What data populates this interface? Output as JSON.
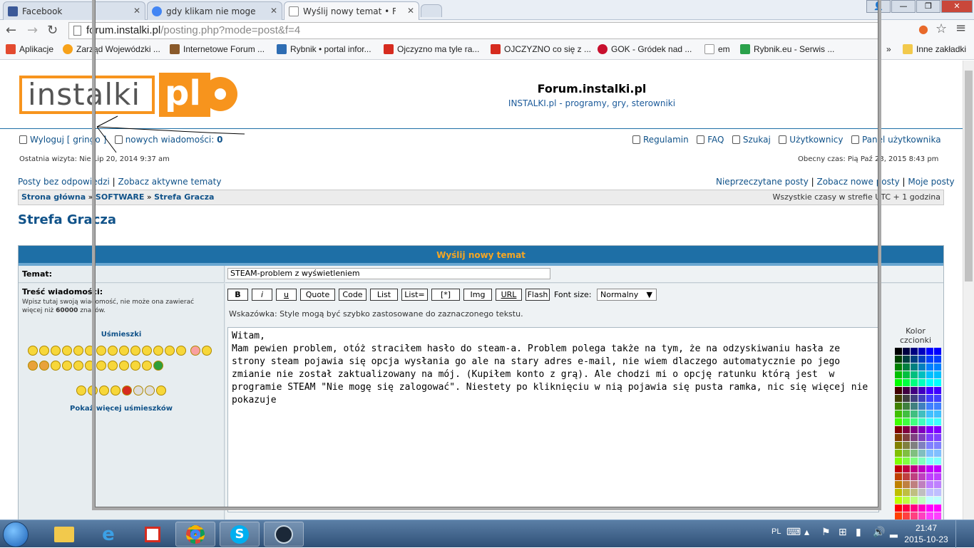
{
  "browser": {
    "tabs": [
      {
        "title": "Facebook",
        "color": "#3b5998"
      },
      {
        "title": "gdy klikam nie moge sie z",
        "color": "#4285f4"
      },
      {
        "title": "Wyślij nowy temat • Forum",
        "color": "#ffffff"
      }
    ],
    "url_host": "forum.instalki.pl",
    "url_path": "/posting.php?mode=post&f=4",
    "bookmarks": [
      {
        "label": "Aplikacje",
        "color": "#e34a2f"
      },
      {
        "label": "Zarząd Wojewódzki ...",
        "color": "#f7a21b"
      },
      {
        "label": "Internetowe Forum ...",
        "color": "#8a5a2b"
      },
      {
        "label": "Rybnik • portal infor...",
        "color": "#2e6db3"
      },
      {
        "label": "Ojczyzno ma tyle ra...",
        "color": "#d62b1f"
      },
      {
        "label": "OJCZYZNO co się z ...",
        "color": "#d62b1f"
      },
      {
        "label": "GOK - Gródek nad ...",
        "color": "#c8102e"
      },
      {
        "label": "em",
        "color": "#e0e0e0"
      },
      {
        "label": "Rybnik.eu - Serwis ...",
        "color": "#2aa14b"
      },
      {
        "label": "»",
        "color": ""
      },
      {
        "label": "Inne zakładki",
        "color": "#f2c94c"
      }
    ]
  },
  "site": {
    "logo_text": "instalki",
    "logo_pl": "pl",
    "title": "Forum.instalki.pl",
    "description": "INSTALKI.pl - programy, gry, sterowniki"
  },
  "userbar": {
    "logout": "Wyloguj [ gringo ]",
    "new_messages_label": "nowych wiadomości:",
    "new_messages_count": "0",
    "links": [
      "Regulamin",
      "FAQ",
      "Szukaj",
      "Użytkownicy",
      "Panel użytkownika"
    ],
    "last_visit": "Ostatnia wizyta: Nie Lip 20, 2014 9:37 am",
    "current_time": "Obecny czas: Pią Paź 23, 2015 8:43 pm"
  },
  "quicklinks": {
    "left": [
      "Posty bez odpowiedzi",
      "Zobacz aktywne tematy"
    ],
    "right": [
      "Nieprzeczytane posty",
      "Zobacz nowe posty",
      "Moje posty"
    ]
  },
  "breadcrumb": {
    "items": [
      "Strona główna",
      "SOFTWARE",
      "Strefa Gracza"
    ],
    "timezone": "Wszystkie czasy w strefie UTC + 1 godzina"
  },
  "page_title": "Strefa Gracza",
  "form": {
    "header": "Wyślij nowy temat",
    "subject_label": "Temat:",
    "subject_value": "STEAM-problem z wyświetleniem",
    "body_label": "Treść wiadomości:",
    "body_hint_1": "Wpisz tutaj swoją wiadomość, nie może ona zawierać",
    "body_hint_2": "więcej niż",
    "body_hint_limit": "60000",
    "body_hint_3": "znaków.",
    "smilies_title": "Uśmieszki",
    "more_smilies": "Pokaż więcej uśmieszków",
    "bbcode_buttons": [
      "B",
      "i",
      "u",
      "Quote",
      "Code",
      "List",
      "List=",
      "[*]",
      "Img",
      "URL",
      "Flash"
    ],
    "font_size_label": "Font size:",
    "font_size_value": "Normalny",
    "tip": "Wskazówka: Style mogą być szybko zastosowane do zaznaczonego tekstu.",
    "message": "Witam,\nMam pewien problem, otóż straciłem hasło do steam-a. Problem polega także na tym, że na odzyskiwaniu hasła ze strony steam pojawia się opcja wysłania go ale na stary adres e-mail, nie wiem dlaczego automatycznie po jego zmianie nie został zaktualizowany na mój. (Kupiłem konto z grą). Ale chodzi mi o opcję ratunku którą jest  w programie STEAM \"Nie mogę się zalogować\". Niestety po kliknięciu w nią pojawia się pusta ramka, nic się więcej nie pokazuje",
    "color_label": "Kolor czcionki"
  },
  "taskbar": {
    "lang": "PL",
    "time": "21:47",
    "date": "2015-10-23"
  }
}
